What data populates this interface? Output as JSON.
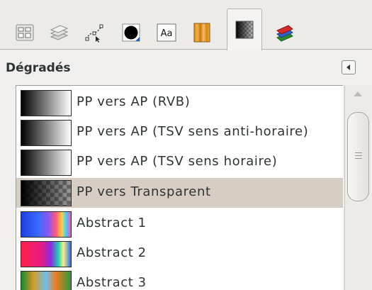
{
  "tabs": [
    {
      "icon": "tool-options-icon"
    },
    {
      "icon": "layers-icon"
    },
    {
      "icon": "paths-icon"
    },
    {
      "icon": "brushes-icon"
    },
    {
      "icon": "fonts-icon"
    },
    {
      "icon": "patterns-icon"
    },
    {
      "icon": "gradients-icon",
      "active": true
    },
    {
      "icon": "palettes-icon"
    }
  ],
  "dock": {
    "title": "Dégradés",
    "menu_icon": "tab-menu-icon"
  },
  "gradients": [
    {
      "label": "PP vers AP (RVB)",
      "swatch": "fg-bg-rgb"
    },
    {
      "label": "PP vers AP (TSV sens anti-horaire)",
      "swatch": "fg-bg-hsv-ccw"
    },
    {
      "label": "PP vers AP (TSV sens horaire)",
      "swatch": "fg-bg-hsv-cw"
    },
    {
      "label": "PP vers Transparent",
      "swatch": "fg-transparent",
      "selected": true
    },
    {
      "label": "Abstract 1",
      "swatch": "abstract-1"
    },
    {
      "label": "Abstract 2",
      "swatch": "abstract-2"
    },
    {
      "label": "Abstract 3",
      "swatch": "abstract-3"
    }
  ],
  "colors": {
    "selection": "#d7cdc3",
    "text": "#2e3436"
  }
}
